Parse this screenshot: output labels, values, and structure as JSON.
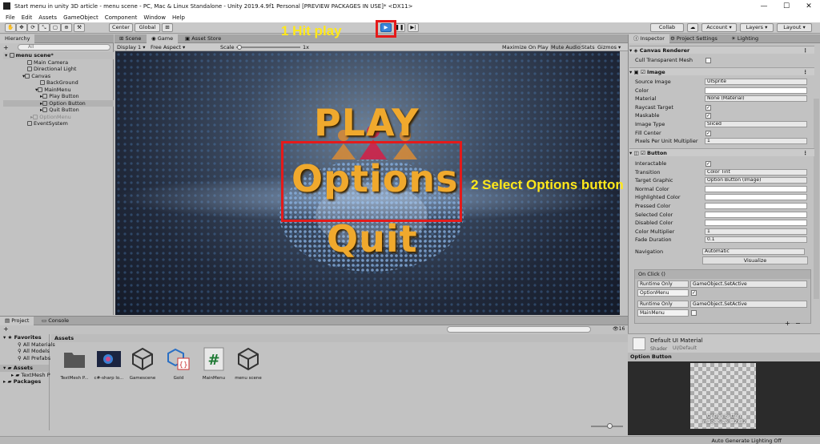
{
  "window": {
    "title": "Start menu in unity 3D article - menu scene - PC, Mac & Linux Standalone - Unity 2019.4.9f1 Personal [PREVIEW PACKAGES IN USE]* <DX11>",
    "minimize": "—",
    "maximize": "☐",
    "close": "✕"
  },
  "menubar": [
    "File",
    "Edit",
    "Assets",
    "GameObject",
    "Component",
    "Window",
    "Help"
  ],
  "toolbar": {
    "pivot": "Center",
    "space": "Global",
    "collab": "Collab",
    "account": "Account",
    "layers": "Layers",
    "layout": "Layout"
  },
  "annotations": {
    "step1": "1 Hit play",
    "step2": "2 Select Options button"
  },
  "hierarchy": {
    "tab": "Hierarchy",
    "search_placeholder": "All",
    "add": "+",
    "items": [
      {
        "label": "menu scene*"
      },
      {
        "label": "Main Camera"
      },
      {
        "label": "Directional Light"
      },
      {
        "label": "Canvas"
      },
      {
        "label": "BackGround"
      },
      {
        "label": "MainMenu"
      },
      {
        "label": "Play Button"
      },
      {
        "label": "Option Button"
      },
      {
        "label": "Quit Button"
      },
      {
        "label": "OptionMenu"
      },
      {
        "label": "EventSystem"
      }
    ]
  },
  "center_tabs": {
    "scene": "Scene",
    "game": "Game",
    "asset_store": "Asset Store"
  },
  "game_toolbar": {
    "display": "Display 1",
    "aspect": "Free Aspect",
    "scale_label": "Scale",
    "scale_value": "1x",
    "maximize": "Maximize On Play",
    "mute": "Mute Audio",
    "stats": "Stats",
    "gizmos": "Gizmos"
  },
  "game_view": {
    "play": "PLAY",
    "options": "Options",
    "quit": "Quit"
  },
  "inspector": {
    "tabs": [
      "Inspector",
      "Project Settings",
      "Lighting"
    ],
    "canvas_renderer": {
      "title": "Canvas Renderer",
      "cull_label": "Cull Transparent Mesh"
    },
    "image": {
      "title": "Image",
      "rows": [
        {
          "label": "Source Image",
          "value": "UISprite"
        },
        {
          "label": "Color",
          "value": ""
        },
        {
          "label": "Material",
          "value": "None (Material)"
        },
        {
          "label": "Raycast Target",
          "value": ""
        },
        {
          "label": "Maskable",
          "value": ""
        },
        {
          "label": "Image Type",
          "value": "Sliced"
        },
        {
          "label": "Fill Center",
          "value": ""
        },
        {
          "label": "Pixels Per Unit Multiplier",
          "value": "1"
        }
      ]
    },
    "button": {
      "title": "Button",
      "rows": [
        {
          "label": "Interactable",
          "value": ""
        },
        {
          "label": "Transition",
          "value": "Color Tint"
        },
        {
          "label": "Target Graphic",
          "value": "Option Button (Image)"
        },
        {
          "label": "Normal Color",
          "value": ""
        },
        {
          "label": "Highlighted Color",
          "value": ""
        },
        {
          "label": "Pressed Color",
          "value": ""
        },
        {
          "label": "Selected Color",
          "value": ""
        },
        {
          "label": "Disabled Color",
          "value": ""
        },
        {
          "label": "Color Multiplier",
          "value": "1"
        },
        {
          "label": "Fade Duration",
          "value": "0.1"
        }
      ],
      "navigation_label": "Navigation",
      "navigation_value": "Automatic",
      "visualize": "Visualize"
    },
    "onclick": {
      "title": "On Click ()",
      "entries": [
        {
          "mode": "Runtime Only",
          "function": "GameObject.SetActive",
          "object": "OptionMenu"
        },
        {
          "mode": "Runtime Only",
          "function": "GameObject.SetActive",
          "object": "MainMenu"
        }
      ],
      "add": "+",
      "remove": "−"
    },
    "material": {
      "title": "Default UI Material",
      "shader_label": "Shader",
      "shader_value": "UI/Default"
    },
    "preview": {
      "title": "Option Button",
      "caption_line1": "Option Button",
      "caption_line2": "Image Size: 32x32"
    }
  },
  "project": {
    "tabs": [
      "Project",
      "Console"
    ],
    "add": "+",
    "count": "16",
    "favorites": {
      "title": "Favorites",
      "items": [
        "All Materials",
        "All Models",
        "All Prefabs"
      ]
    },
    "tree": {
      "assets": "Assets",
      "textmesh": "TextMesh P",
      "packages": "Packages"
    },
    "breadcrumb": "Assets",
    "assets": [
      {
        "name": "TextMesh P...",
        "icon": "folder-icon"
      },
      {
        "name": "c#-sharp lo...",
        "icon": "image-icon"
      },
      {
        "name": "Gamescene",
        "icon": "unity-scene-icon"
      },
      {
        "name": "Gold",
        "icon": "material-icon"
      },
      {
        "name": "MainMenu",
        "icon": "csharp-script-icon"
      },
      {
        "name": "menu scene",
        "icon": "unity-scene-icon"
      }
    ]
  },
  "statusbar": {
    "lighting": "Auto Generate Lighting Off"
  }
}
